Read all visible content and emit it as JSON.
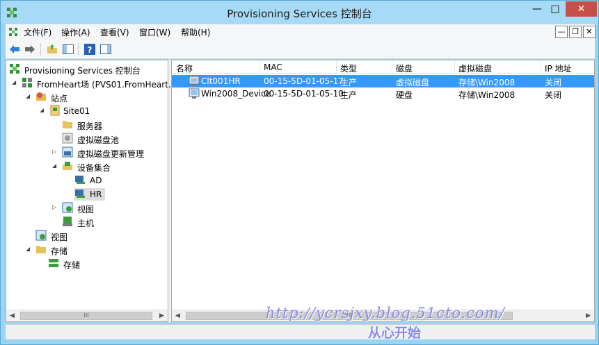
{
  "window": {
    "title": "Provisioning Services 控制台"
  },
  "menu": {
    "items": [
      "文件(F)",
      "操作(A)",
      "查看(V)",
      "窗口(W)",
      "帮助(H)"
    ]
  },
  "tree": {
    "root": "Provisioning Services 控制台",
    "farm": "FromHeart场 (PVS01.FromHeart.",
    "sites": "站点",
    "site01": "Site01",
    "servers": "服务器",
    "vdisk_pool": "虚拟磁盘池",
    "vdisk_update": "虚拟磁盘更新管理",
    "device_collections": "设备集合",
    "ad": "AD",
    "hr": "HR",
    "site_views": "视图",
    "hosts": "主机",
    "farm_views": "视图",
    "stores": "存储",
    "store": "存储"
  },
  "list": {
    "columns": [
      "名称",
      "MAC",
      "类型",
      "磁盘",
      "虚拟磁盘",
      "IP 地址"
    ],
    "rows": [
      {
        "name": "Clt001HR",
        "mac": "00-15-5D-01-05-17",
        "type": "生产",
        "disk": "虚拟磁盘",
        "vdisk": "存储\\Win2008",
        "ip": "关闭",
        "selected": true
      },
      {
        "name": "Win2008_Device",
        "mac": "00-15-5D-01-05-10",
        "type": "生产",
        "disk": "硬盘",
        "vdisk": "存储\\Win2008",
        "ip": "关闭",
        "selected": false
      }
    ]
  },
  "watermark": {
    "url": "http://ycrsjxy.blog.51cto.com/",
    "caption": "从心开始"
  },
  "colors": {
    "selection": "#3399ff",
    "titlebar": "#a7daf6",
    "close": "#c74f4a"
  },
  "icons": {
    "toolbar": [
      "back-arrow-icon",
      "forward-arrow-icon",
      "up-folder-icon",
      "show-hide-tree-icon",
      "help-icon",
      "action-pane-icon"
    ]
  }
}
